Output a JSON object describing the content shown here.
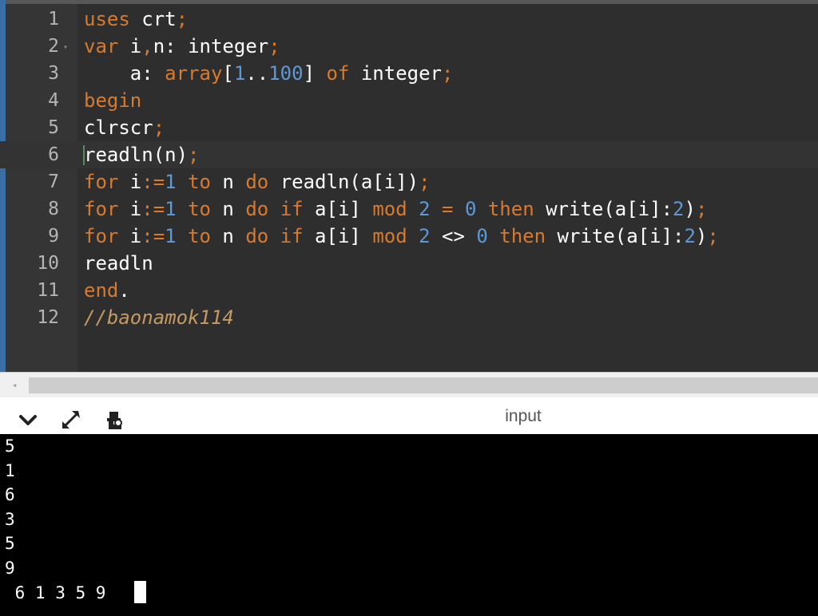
{
  "editor": {
    "lines": [
      {
        "num": "1",
        "tokens": [
          {
            "t": "uses",
            "c": "kw"
          },
          {
            "t": " crt",
            "c": "id"
          },
          {
            "t": ";",
            "c": "pn"
          }
        ]
      },
      {
        "num": "2",
        "fold": true,
        "tokens": [
          {
            "t": "var",
            "c": "kw"
          },
          {
            "t": " i",
            "c": "id"
          },
          {
            "t": ",",
            "c": "pn"
          },
          {
            "t": "n: integer",
            "c": "id"
          },
          {
            "t": ";",
            "c": "pn"
          }
        ]
      },
      {
        "num": "3",
        "tokens": [
          {
            "t": "    a: ",
            "c": "id"
          },
          {
            "t": "array",
            "c": "kw"
          },
          {
            "t": "[",
            "c": "id"
          },
          {
            "t": "1",
            "c": "num"
          },
          {
            "t": "..",
            "c": "id"
          },
          {
            "t": "100",
            "c": "num"
          },
          {
            "t": "] ",
            "c": "id"
          },
          {
            "t": "of",
            "c": "kw"
          },
          {
            "t": " integer",
            "c": "id"
          },
          {
            "t": ";",
            "c": "pn"
          }
        ]
      },
      {
        "num": "4",
        "tokens": [
          {
            "t": "begin",
            "c": "kw"
          }
        ]
      },
      {
        "num": "5",
        "tokens": [
          {
            "t": "clrscr",
            "c": "id"
          },
          {
            "t": ";",
            "c": "pn"
          }
        ]
      },
      {
        "num": "6",
        "active": true,
        "tokens": [
          {
            "t": "readln(n)",
            "c": "id"
          },
          {
            "t": ";",
            "c": "pn"
          }
        ]
      },
      {
        "num": "7",
        "tokens": [
          {
            "t": "for",
            "c": "kw"
          },
          {
            "t": " i",
            "c": "id"
          },
          {
            "t": ":=",
            "c": "pn"
          },
          {
            "t": "1",
            "c": "num"
          },
          {
            "t": " ",
            "c": "id"
          },
          {
            "t": "to",
            "c": "kw"
          },
          {
            "t": " n ",
            "c": "id"
          },
          {
            "t": "do",
            "c": "kw"
          },
          {
            "t": " readln(a[i])",
            "c": "id"
          },
          {
            "t": ";",
            "c": "pn"
          }
        ]
      },
      {
        "num": "8",
        "tokens": [
          {
            "t": "for",
            "c": "kw"
          },
          {
            "t": " i",
            "c": "id"
          },
          {
            "t": ":=",
            "c": "pn"
          },
          {
            "t": "1",
            "c": "num"
          },
          {
            "t": " ",
            "c": "id"
          },
          {
            "t": "to",
            "c": "kw"
          },
          {
            "t": " n ",
            "c": "id"
          },
          {
            "t": "do",
            "c": "kw"
          },
          {
            "t": " ",
            "c": "id"
          },
          {
            "t": "if",
            "c": "kw"
          },
          {
            "t": " a[i] ",
            "c": "id"
          },
          {
            "t": "mod",
            "c": "kw"
          },
          {
            "t": " ",
            "c": "id"
          },
          {
            "t": "2",
            "c": "num"
          },
          {
            "t": " ",
            "c": "id"
          },
          {
            "t": "=",
            "c": "pn"
          },
          {
            "t": " ",
            "c": "id"
          },
          {
            "t": "0",
            "c": "num"
          },
          {
            "t": " ",
            "c": "id"
          },
          {
            "t": "then",
            "c": "kw"
          },
          {
            "t": " write(a[i]:",
            "c": "id"
          },
          {
            "t": "2",
            "c": "num"
          },
          {
            "t": ")",
            "c": "id"
          },
          {
            "t": ";",
            "c": "pn"
          }
        ]
      },
      {
        "num": "9",
        "tokens": [
          {
            "t": "for",
            "c": "kw"
          },
          {
            "t": " i",
            "c": "id"
          },
          {
            "t": ":=",
            "c": "pn"
          },
          {
            "t": "1",
            "c": "num"
          },
          {
            "t": " ",
            "c": "id"
          },
          {
            "t": "to",
            "c": "kw"
          },
          {
            "t": " n ",
            "c": "id"
          },
          {
            "t": "do",
            "c": "kw"
          },
          {
            "t": " ",
            "c": "id"
          },
          {
            "t": "if",
            "c": "kw"
          },
          {
            "t": " a[i] ",
            "c": "id"
          },
          {
            "t": "mod",
            "c": "kw"
          },
          {
            "t": " ",
            "c": "id"
          },
          {
            "t": "2",
            "c": "num"
          },
          {
            "t": " <> ",
            "c": "id"
          },
          {
            "t": "0",
            "c": "num"
          },
          {
            "t": " ",
            "c": "id"
          },
          {
            "t": "then",
            "c": "kw"
          },
          {
            "t": " write(a[i]:",
            "c": "id"
          },
          {
            "t": "2",
            "c": "num"
          },
          {
            "t": ")",
            "c": "id"
          },
          {
            "t": ";",
            "c": "pn"
          }
        ]
      },
      {
        "num": "10",
        "tokens": [
          {
            "t": "readln",
            "c": "id"
          }
        ]
      },
      {
        "num": "11",
        "tokens": [
          {
            "t": "end",
            "c": "kw"
          },
          {
            "t": ".",
            "c": "id"
          }
        ]
      },
      {
        "num": "12",
        "tokens": [
          {
            "t": "//baonamok114",
            "c": "cm"
          }
        ]
      }
    ]
  },
  "scrollbar": {
    "left_arrow": "◂"
  },
  "panel": {
    "title": "input",
    "icons": [
      "chevron-down-icon",
      "expand-icon",
      "run-settings-icon"
    ]
  },
  "console": {
    "lines": [
      "5",
      "1",
      "6",
      "3",
      "5",
      "9",
      " 6 1 3 5 9"
    ]
  }
}
